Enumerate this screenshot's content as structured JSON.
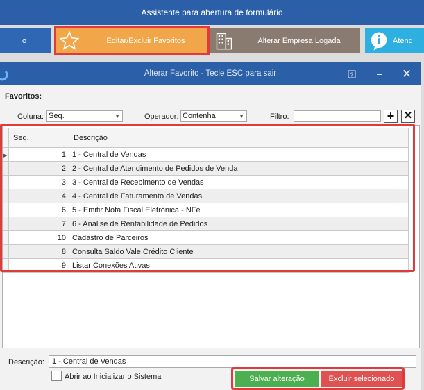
{
  "app": {
    "title": "Assistente para abertura de formulário"
  },
  "tiles": [
    {
      "label": "o",
      "icon": "none"
    },
    {
      "label": "Editar/Excluir Favoritos",
      "icon": "star-icon"
    },
    {
      "label": "Alterar Empresa Logada",
      "icon": "building-icon"
    },
    {
      "label": "Atend",
      "icon": "info-bubble-icon"
    }
  ],
  "dialog": {
    "title": "Alterar Favorito - Tecle ESC para sair",
    "section_label": "Favoritos:",
    "filters": {
      "coluna_label": "Coluna:",
      "coluna_value": "Seq.",
      "operador_label": "Operador:",
      "operador_value": "Contenha",
      "filtro_label": "Filtro:",
      "filtro_value": ""
    },
    "table": {
      "headers": [
        "Seq.",
        "Descrição"
      ],
      "rows": [
        {
          "seq": "1",
          "desc": "1 - Central de Vendas"
        },
        {
          "seq": "2",
          "desc": "2 - Central de Atendimento de Pedidos de Venda"
        },
        {
          "seq": "3",
          "desc": "3 - Central de Recebimento de Vendas"
        },
        {
          "seq": "4",
          "desc": "4 - Central de Faturamento de Vendas"
        },
        {
          "seq": "6",
          "desc": "5 - Emitir Nota Fiscal Eletrônica - NFe"
        },
        {
          "seq": "7",
          "desc": "6 - Analise de Rentabilidade de Pedidos"
        },
        {
          "seq": "10",
          "desc": "Cadastro de Parceiros"
        },
        {
          "seq": "8",
          "desc": "Consulta Saldo Vale Crédito Cliente"
        },
        {
          "seq": "9",
          "desc": "Listar Conexões Ativas"
        }
      ]
    },
    "descricao_label": "Descrição:",
    "descricao_value": "1 - Central de Vendas",
    "checkbox_label": "Abrir ao Inicializar o Sistema",
    "save_label": "Salvar alteração",
    "delete_label": "Excluir selecionado"
  },
  "colors": {
    "primary": "#2b5fa8",
    "highlight": "#e03a3a",
    "save": "#4caf50",
    "delete": "#e05252",
    "favorites_tile": "#f2a64a"
  }
}
